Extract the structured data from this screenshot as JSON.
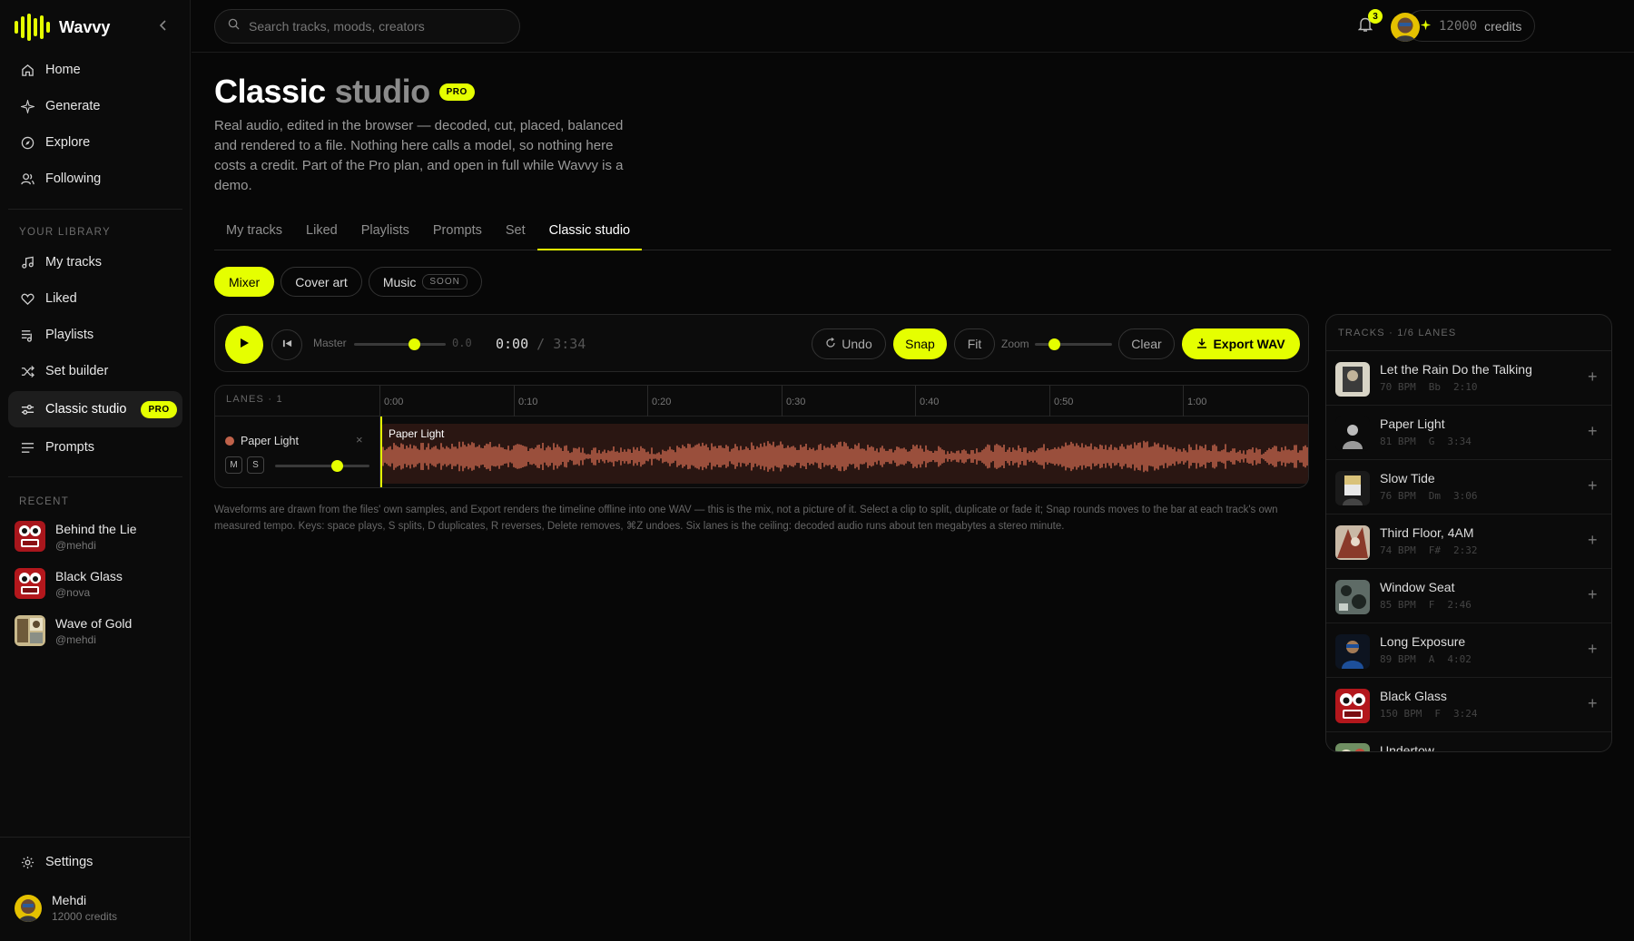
{
  "brand": {
    "name": "Wavvy"
  },
  "nav": [
    {
      "label": "Home",
      "icon": "home-icon"
    },
    {
      "label": "Generate",
      "icon": "sparkle-icon"
    },
    {
      "label": "Explore",
      "icon": "compass-icon"
    },
    {
      "label": "Following",
      "icon": "users-icon"
    }
  ],
  "library": {
    "section_label": "YOUR LIBRARY",
    "items": [
      {
        "label": "My tracks",
        "icon": "music-note-icon"
      },
      {
        "label": "Liked",
        "icon": "heart-icon"
      },
      {
        "label": "Playlists",
        "icon": "playlist-icon"
      },
      {
        "label": "Set builder",
        "icon": "shuffle-icon"
      },
      {
        "label": "Classic studio",
        "icon": "sliders-icon",
        "badge": "PRO",
        "active": true
      },
      {
        "label": "Prompts",
        "icon": "lines-icon"
      }
    ]
  },
  "recent": {
    "section_label": "RECENT",
    "items": [
      {
        "title": "Behind the Lie",
        "user": "@mehdi"
      },
      {
        "title": "Black Glass",
        "user": "@nova"
      },
      {
        "title": "Wave of Gold",
        "user": "@mehdi"
      }
    ]
  },
  "footer": {
    "settings_label": "Settings",
    "user_name": "Mehdi",
    "user_credits": "12000 credits"
  },
  "topbar": {
    "search_placeholder": "Search tracks, moods, creators",
    "credits_value": "12000",
    "credits_label": "credits",
    "notification_count": "3"
  },
  "page": {
    "title_main": "Classic",
    "title_muted": "studio",
    "title_badge": "PRO",
    "description": "Real audio, edited in the browser — decoded, cut, placed, balanced and rendered to a file. Nothing here calls a model, so nothing here costs a credit. Part of the Pro plan, and open in full while Wavvy is a demo."
  },
  "tabs": [
    "My tracks",
    "Liked",
    "Playlists",
    "Prompts",
    "Set",
    "Classic studio"
  ],
  "active_tab": "Classic studio",
  "chips": {
    "mixer": "Mixer",
    "cover_art": "Cover art",
    "music": "Music",
    "music_tag": "SOON"
  },
  "transport": {
    "master_label": "Master",
    "master_value": "0.0",
    "master_level": 0.65,
    "time_current": "0:00",
    "time_total": "/ 3:34",
    "undo": "Undo",
    "snap": "Snap",
    "fit": "Fit",
    "zoom_label": "Zoom",
    "zoom_level": 0.25,
    "clear": "Clear",
    "export": "Export WAV"
  },
  "lanes": {
    "header": "LANES · 1",
    "ruler": [
      "0:00",
      "0:10",
      "0:20",
      "0:30",
      "0:40",
      "0:50",
      "1:00"
    ],
    "lane": {
      "name": "Paper Light",
      "mute": "M",
      "solo": "S",
      "remove": "×",
      "volume_level": 0.65,
      "clip_name": "Paper Light",
      "color": "#c0624a"
    }
  },
  "note": "Waveforms are drawn from the files' own samples, and Export renders the timeline offline into one WAV — this is the mix, not a picture of it. Select a clip to split, duplicate or fade it; Snap rounds moves to the bar at each track's own measured tempo. Keys: space plays, S splits, D duplicates, R reverses, Delete removes, ⌘Z undoes. Six lanes is the ceiling: decoded audio runs about ten megabytes a stereo minute.",
  "tracks_panel": {
    "header": "TRACKS · 1/6 LANES",
    "items": [
      {
        "name": "Let the Rain Do the Talking",
        "bpm": "70 BPM",
        "key": "Bb",
        "dur": "2:10"
      },
      {
        "name": "Paper Light",
        "bpm": "81 BPM",
        "key": "G",
        "dur": "3:34"
      },
      {
        "name": "Slow Tide",
        "bpm": "76 BPM",
        "key": "Dm",
        "dur": "3:06"
      },
      {
        "name": "Third Floor, 4AM",
        "bpm": "74 BPM",
        "key": "F#",
        "dur": "2:32"
      },
      {
        "name": "Window Seat",
        "bpm": "85 BPM",
        "key": "F",
        "dur": "2:46"
      },
      {
        "name": "Long Exposure",
        "bpm": "89 BPM",
        "key": "A",
        "dur": "4:02"
      },
      {
        "name": "Black Glass",
        "bpm": "150 BPM",
        "key": "F",
        "dur": "3:24"
      },
      {
        "name": "Undertow",
        "bpm": "",
        "key": "",
        "dur": ""
      }
    ]
  },
  "colors": {
    "accent": "#e5ff00",
    "lane": "#c0624a",
    "background": "#070707"
  }
}
